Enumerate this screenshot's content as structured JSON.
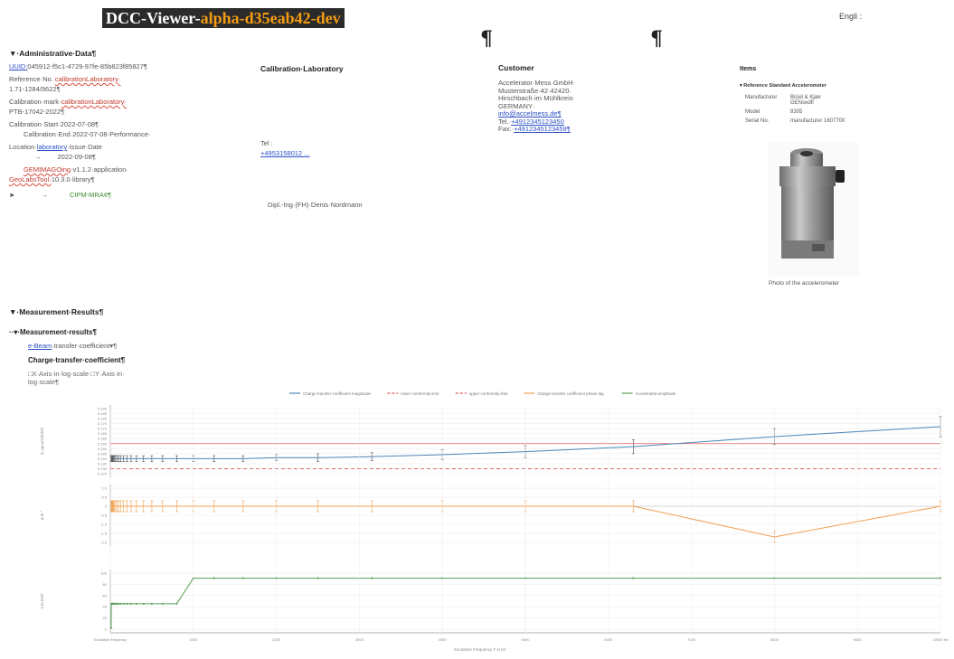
{
  "header": {
    "app_title": "DCC-Viewer-",
    "version": "alpha-d35eab42-dev",
    "language": "Engli :"
  },
  "pilcrows": [
    "¶",
    "¶"
  ],
  "admin": {
    "heading": "▼·Administrative·Data¶",
    "uuid_label": "UUID:",
    "uuid_value": "045912-f5c1-4729-97fe-85b823f85827¶",
    "ref_label": "Reference·No.",
    "ref_red": "calibrationLaboratory·",
    "ref_value": "1.71-1284/9622¶",
    "mark_label": "Calibration·mark·",
    "mark_red": "calibrationLaboratory·",
    "mark_value": "PTB-17042-2022¶",
    "start": "Calibration·Start·2022-07-08¶",
    "end": "Calibration·End·2022-07-08·Performance·",
    "location_label": "Location·",
    "location_link": "laboratory",
    "issue_label": "·Issue·Date",
    "issue_value": "2022-09-08¶",
    "software_red": "GEMIMAGOing",
    "software_value": "·v1.1.2·application·",
    "library_red": "GeoLabsTool·",
    "library_value": "10.3.0·library¶",
    "cipm_arrow": "►",
    "cipm": "CIPM-MRA¢¶"
  },
  "lab": {
    "heading": "Calibration·Laboratory",
    "tel_label": "Tel :",
    "tel_value": "+4953158012 ...",
    "signer": "Dipl.-Ing·(FH)·Denis·Nordmann"
  },
  "customer": {
    "heading": "Customer",
    "lines": [
      "Accelerator·Mess·GmbH·",
      "Musterstraße·42·42420·",
      "Hirschbach·im·Mühlkreis·",
      "GERMANY·"
    ],
    "email": "info@accelmess.de¶",
    "tel_label": "Tel.·",
    "tel_value": "+4912345123450",
    "fax_label": "Fax:·",
    "fax_value": "+4912345123459¶"
  },
  "items": {
    "heading": "Items",
    "subheading": "▾ Reference Standard Accelerometer",
    "rows": [
      {
        "label": "Manufacturer",
        "value": "Brüel & Kjær GENsedfi"
      },
      {
        "label": "Model",
        "value": "8305"
      },
      {
        "label": "Serial No.",
        "value": "manufacturer 1607700"
      }
    ],
    "serial_link": "Serial No.",
    "photo_caption": "Photo of the accelerometer"
  },
  "measurement": {
    "heading": "▼·Measurement·Results¶",
    "subheading": "··▾·Measurement·results¶",
    "transfer_link": "e-Beam",
    "transfer_text": "·transfer·coefficient▾¶",
    "charge_heading": "Charge·transfer·coefficient¶",
    "axis_note_1": "□X·Axis·in·log·scale·□Y·Axis·in·",
    "axis_note_2": "log·scale¶"
  },
  "colors": {
    "blue": "#4a86b8",
    "orange": "#f0a050",
    "green": "#5aa05a",
    "red": "#e05a5a",
    "grid": "#e8e8e8"
  },
  "chart_data": {
    "type": "line",
    "legend": [
      "Charge transfer coefficient magnitude",
      "lower conformity limit",
      "upper conformity limit",
      "Charge transfer coefficient phase lag",
      "Accelerated amplitude"
    ],
    "legend_colors": [
      "#4a86b8",
      "#e05a5a",
      "#e05a5a",
      "#f0a050",
      "#5aa05a"
    ],
    "x_ticks": [
      "Excitation frequency",
      "1000",
      "2000",
      "3000",
      "4000",
      "5000",
      "6000",
      "7000",
      "8000",
      "9000",
      "10000 Hz"
    ],
    "xlabel": "Excitation Frequency F in Hz",
    "x": [
      10,
      12.5,
      16,
      20,
      25,
      31.5,
      40,
      50,
      63,
      80,
      100,
      125,
      160,
      200,
      250,
      315,
      400,
      500,
      630,
      800,
      1000,
      1250,
      1600,
      2000,
      2500,
      3150,
      4000,
      5000,
      6300,
      8000,
      10000
    ],
    "xlim": [
      0,
      10000
    ],
    "panels": [
      {
        "ylabel": "S_qa pC/(m/s²)",
        "ylim": [
          0.125,
          0.19
        ],
        "y_ticks": [
          "0.190",
          "0.185",
          "0.180",
          "0.175",
          "0.170",
          "0.165",
          "0.160",
          "0.155",
          "0.150",
          "0.145",
          "0.140",
          "0.135",
          "0.130",
          "0.125"
        ],
        "upper_limit": 0.155,
        "lower_limit": 0.13,
        "values": [
          0.14,
          0.14,
          0.14,
          0.14,
          0.14,
          0.14,
          0.14,
          0.14,
          0.14,
          0.14,
          0.14,
          0.14,
          0.14,
          0.14,
          0.14,
          0.14,
          0.14,
          0.14,
          0.14,
          0.14,
          0.14,
          0.14,
          0.14,
          0.141,
          0.141,
          0.142,
          0.144,
          0.147,
          0.152,
          0.162,
          0.172
        ],
        "err": [
          0.003,
          0.003,
          0.003,
          0.003,
          0.003,
          0.003,
          0.003,
          0.003,
          0.003,
          0.003,
          0.003,
          0.003,
          0.003,
          0.003,
          0.003,
          0.003,
          0.003,
          0.003,
          0.003,
          0.003,
          0.003,
          0.003,
          0.003,
          0.003,
          0.004,
          0.004,
          0.005,
          0.006,
          0.007,
          0.008,
          0.01
        ]
      },
      {
        "ylabel": "φ in °",
        "ylim": [
          -2.0,
          1.0
        ],
        "y_ticks": [
          "1.0",
          "0.5",
          "0",
          "-0.5",
          "-1.0",
          "-1.5",
          "-2.0"
        ],
        "values": [
          0,
          0,
          0,
          0,
          0,
          0,
          0,
          0,
          0,
          0,
          0,
          0,
          0,
          0,
          0,
          0,
          0,
          0,
          0,
          0,
          0,
          0,
          0,
          0,
          0,
          0,
          0,
          0,
          0,
          -1.7,
          0
        ],
        "err": [
          0.3,
          0.3,
          0.3,
          0.3,
          0.3,
          0.3,
          0.3,
          0.3,
          0.3,
          0.3,
          0.3,
          0.3,
          0.3,
          0.3,
          0.3,
          0.3,
          0.3,
          0.3,
          0.3,
          0.3,
          0.3,
          0.3,
          0.3,
          0.3,
          0.3,
          0.3,
          0.3,
          0.3,
          0.3,
          0.3,
          0.3
        ]
      },
      {
        "ylabel": "a in m/s²",
        "ylim": [
          0,
          110
        ],
        "y_ticks": [
          "100",
          "80",
          "60",
          "40",
          "20",
          "0"
        ],
        "values": [
          2,
          50,
          50,
          50,
          50,
          50,
          50,
          50,
          50,
          50,
          50,
          50,
          50,
          50,
          50,
          50,
          50,
          50,
          50,
          50,
          100,
          100,
          100,
          100,
          100,
          100,
          100,
          100,
          100,
          100,
          100
        ],
        "err": []
      }
    ]
  }
}
